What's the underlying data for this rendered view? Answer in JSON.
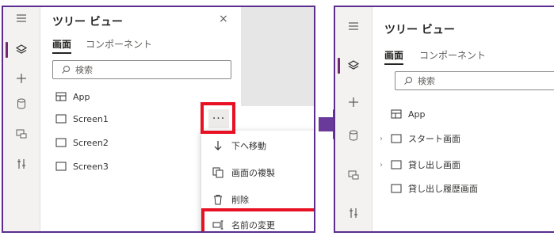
{
  "left": {
    "title": "ツリー ビュー",
    "close_glyph": "×",
    "tabs": [
      {
        "label": "画面",
        "active": true
      },
      {
        "label": "コンポーネント",
        "active": false
      }
    ],
    "search_placeholder": "検索",
    "tree": [
      {
        "label": "App",
        "icon": "app-icon"
      },
      {
        "label": "Screen1",
        "icon": "screen-icon"
      },
      {
        "label": "Screen2",
        "icon": "screen-icon"
      },
      {
        "label": "Screen3",
        "icon": "screen-icon"
      }
    ],
    "more_glyph": "···",
    "menu": [
      {
        "label": "下へ移動",
        "icon": "arrow-down-icon"
      },
      {
        "label": "画面の複製",
        "icon": "duplicate-icon"
      },
      {
        "label": "削除",
        "icon": "trash-icon"
      },
      {
        "label": "名前の変更",
        "icon": "rename-icon"
      }
    ]
  },
  "right": {
    "title": "ツリー ビュー",
    "tabs": [
      {
        "label": "画面",
        "active": true
      },
      {
        "label": "コンポーネント",
        "active": false
      }
    ],
    "search_placeholder": "検索",
    "tree": [
      {
        "label": "App",
        "icon": "app-icon",
        "chevron": false
      },
      {
        "label": "スタート画面",
        "icon": "screen-icon",
        "chevron": true
      },
      {
        "label": "貸し出し画面",
        "icon": "screen-icon",
        "chevron": true
      },
      {
        "label": "貸し出し履歴画面",
        "icon": "screen-icon",
        "chevron": false
      }
    ]
  },
  "colors": {
    "frame": "#5b2d8e",
    "highlight": "#e81123",
    "accent": "#742774",
    "arrow": "#6a3a9a"
  },
  "rail_icons": [
    "hamburger-icon",
    "layers-icon",
    "plus-icon",
    "database-icon",
    "media-icon",
    "tools-icon"
  ]
}
